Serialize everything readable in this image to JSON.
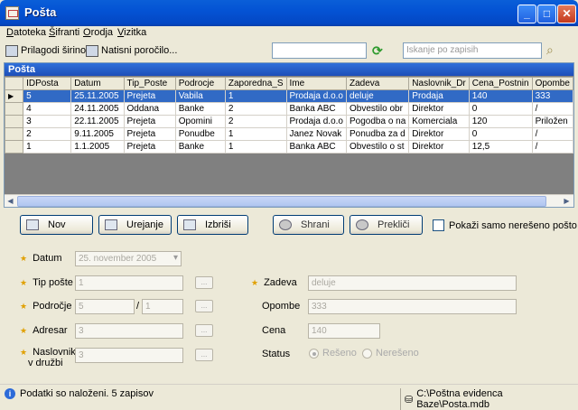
{
  "window": {
    "title": "Pošta",
    "min_icon": "minimize-icon",
    "max_icon": "maximize-icon",
    "close_icon": "close-icon"
  },
  "menu": [
    {
      "label": "Datoteka",
      "underline": "D"
    },
    {
      "label": "Šifranti",
      "underline": "Š"
    },
    {
      "label": "Orodja",
      "underline": "O"
    },
    {
      "label": "Vizitka",
      "underline": "V"
    }
  ],
  "toolbar": {
    "fit_width": "Prilagodi širino",
    "print_report": "Natisni poročilo...",
    "filter_value": "",
    "search_placeholder": "Iskanje po zapisih"
  },
  "grid": {
    "title": "Pošta",
    "columns": [
      "IDPosta",
      "Datum",
      "Tip_Poste",
      "Podrocje",
      "Zaporedna_S",
      "Ime",
      "Zadeva",
      "Naslovnik_Dr",
      "Cena_Postnin",
      "Opombe"
    ],
    "rows": [
      [
        "5",
        "25.11.2005",
        "Prejeta",
        "Vabila",
        "1",
        "Prodaja d.o.o",
        "deluje",
        "Prodaja",
        "140",
        "333"
      ],
      [
        "4",
        "24.11.2005",
        "Oddana",
        "Banke",
        "2",
        "Banka ABC",
        "Obvestilo obr",
        "Direktor",
        "0",
        "/"
      ],
      [
        "3",
        "22.11.2005",
        "Prejeta",
        "Opomini",
        "2",
        "Prodaja d.o.o",
        "Pogodba o na",
        "Komerciala",
        "120",
        "Priložen"
      ],
      [
        "2",
        "9.11.2005",
        "Prejeta",
        "Ponudbe",
        "1",
        "Janez Novak",
        "Ponudba za d",
        "Direktor",
        "0",
        "/"
      ],
      [
        "1",
        "1.1.2005",
        "Prejeta",
        "Banke",
        "1",
        "Banka ABC",
        "Obvestilo o st",
        "Direktor",
        "12,5",
        "/"
      ]
    ],
    "selected_row": 0
  },
  "actions": {
    "new": "Nov",
    "edit": "Urejanje",
    "delete": "Izbriši",
    "save": "Shrani",
    "cancel": "Prekliči",
    "unresolved_only": "Pokaži samo nerešeno pošto"
  },
  "form": {
    "datum_label": "Datum",
    "datum_value": "25. november 2005",
    "tip_label": "Tip pošte",
    "tip_value": "1",
    "podrocje_label": "Področje",
    "podrocje_value1": "5",
    "podrocje_value2": "1",
    "adresar_label": "Adresar",
    "adresar_value": "3",
    "naslovnik_label_1": "Naslovnik",
    "naslovnik_label_2": "v družbi",
    "naslovnik_value": "3",
    "zadeva_label": "Zadeva",
    "zadeva_value": "deluje",
    "opombe_label": "Opombe",
    "opombe_value": "333",
    "cena_label": "Cena",
    "cena_value": "140",
    "status_label": "Status",
    "status_resolved": "Rešeno",
    "status_unresolved": "Nerešeno",
    "ellipsis": "..."
  },
  "status": {
    "message": "Podatki so naloženi. 5 zapisov",
    "db_path": "C:\\Poštna evidenca Baze\\Posta.mdb"
  },
  "colors": {
    "title_bar": "#0453d4",
    "selection": "#316ac5",
    "required_star": "#e0a000"
  }
}
